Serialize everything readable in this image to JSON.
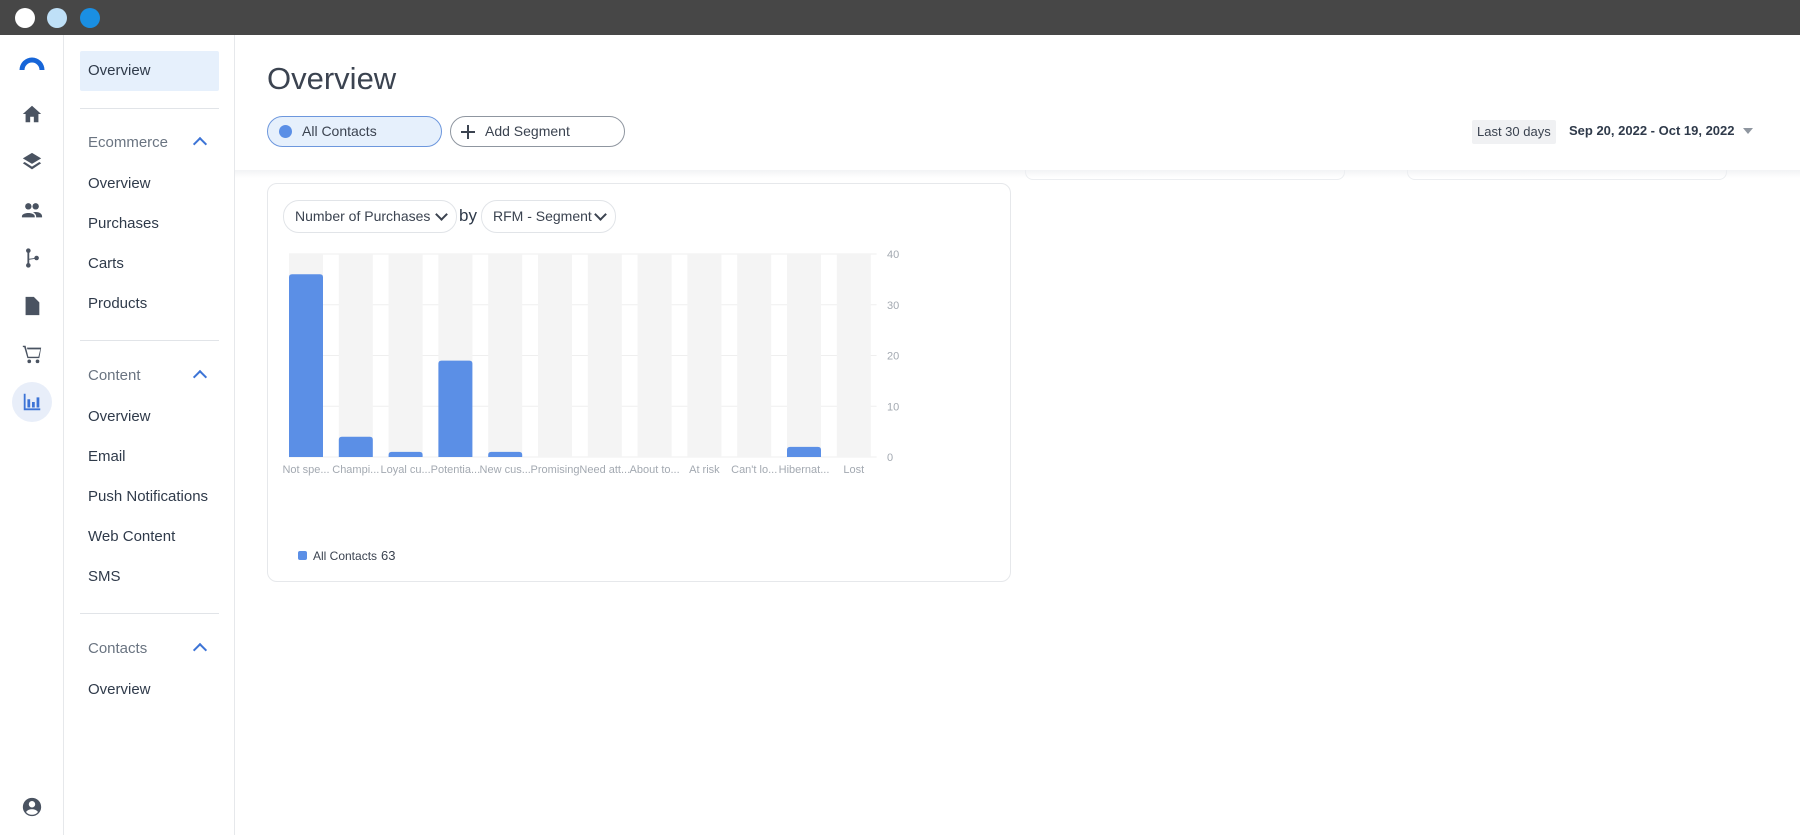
{
  "window": {
    "dots": [
      "#ffffff",
      "#bfe0f7",
      "#1a8fe3"
    ]
  },
  "rail": {
    "icons": [
      "logo-icon",
      "home-icon",
      "layers-icon",
      "people-icon",
      "flow-icon",
      "document-icon",
      "cart-icon",
      "chart-icon",
      "account-icon"
    ],
    "active": "chart-icon"
  },
  "nav": {
    "top": "Overview",
    "sections": [
      {
        "title": "Ecommerce",
        "items": [
          "Overview",
          "Purchases",
          "Carts",
          "Products"
        ]
      },
      {
        "title": "Content",
        "items": [
          "Overview",
          "Email",
          "Push Notifications",
          "Web Content",
          "SMS"
        ]
      },
      {
        "title": "Contacts",
        "items": [
          "Overview"
        ]
      }
    ]
  },
  "header": {
    "title": "Overview",
    "segment_all": "All Contacts",
    "segment_add": "Add Segment",
    "range_label": "Last 30 days",
    "range_value": "Sep 20, 2022 - Oct 19, 2022"
  },
  "card": {
    "metric": "Number of Purchases",
    "by": "by",
    "dimension": "RFM - Segment",
    "legend_label": "All Contacts",
    "legend_total": "63"
  },
  "chart_data": {
    "type": "bar",
    "categories": [
      "Not spe...",
      "Champi...",
      "Loyal cu...",
      "Potentia...",
      "New cus...",
      "Promising",
      "Need att...",
      "About to...",
      "At risk",
      "Can't lo...",
      "Hibernat...",
      "Lost"
    ],
    "series": [
      {
        "name": "All Contacts",
        "values": [
          36,
          4,
          1,
          19,
          1,
          0,
          0,
          0,
          0,
          0,
          2,
          0
        ]
      }
    ],
    "yticks": [
      0,
      10,
      20,
      30,
      40
    ],
    "ylim": [
      0,
      40
    ],
    "y_axis_side": "right",
    "grid": true,
    "legend": "bottom-left",
    "bar_color": "#5b8fe6",
    "track_color": "#f4f4f4"
  },
  "colors": {
    "accent": "#3d74d6",
    "bar": "#5b8fe6"
  }
}
